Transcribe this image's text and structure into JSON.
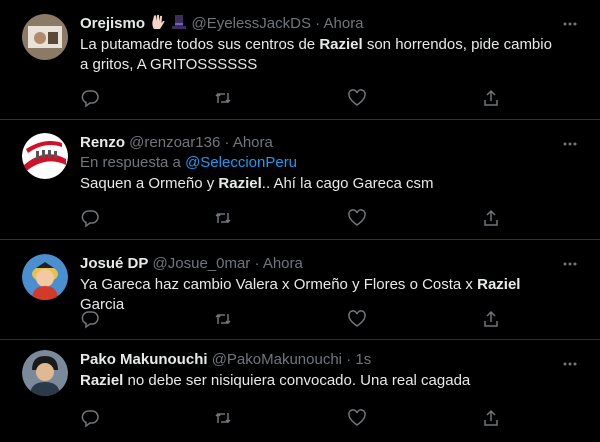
{
  "tweets": [
    {
      "name": "Orejismo",
      "handle": "@EyelessJackDS",
      "sep": "·",
      "time": "Ahora",
      "icons": [
        "hand-emoji",
        "top-hat-emoji"
      ],
      "text_parts": [
        "La putamadre todos sus centros de ",
        "Raziel",
        " son horrendos, pide cambio a gritos, A GRITOSSSSSS"
      ]
    },
    {
      "name": "Renzo",
      "handle": "@renzoar136",
      "sep": "·",
      "time": "Ahora",
      "reply_prefix": "En respuesta a ",
      "reply_to": "@SeleccionPeru",
      "text_parts": [
        "Saquen a Ormeño y ",
        "Raziel",
        ".. Ahí la cago Gareca csm"
      ]
    },
    {
      "name": "Josué DP",
      "handle": "@Josue_0mar",
      "sep": "·",
      "time": "Ahora",
      "text_parts": [
        "Ya Gareca haz cambio Valera x Ormeño y Flores o Costa x ",
        "Raziel",
        " Garcia"
      ]
    },
    {
      "name": "Pako Makunouchi",
      "handle": "@PakoMakunouchi",
      "sep": "·",
      "time": "1s",
      "text_parts": [
        "",
        "Raziel",
        " no debe ser nisiquiera convocado. Una real cagada"
      ]
    }
  ],
  "colors": {
    "background": "#000000",
    "divider": "#2f3336",
    "secondary_text": "#71767b",
    "link": "#1d9bf0"
  },
  "action_icons": [
    "reply-icon",
    "retweet-icon",
    "like-icon",
    "share-icon"
  ]
}
